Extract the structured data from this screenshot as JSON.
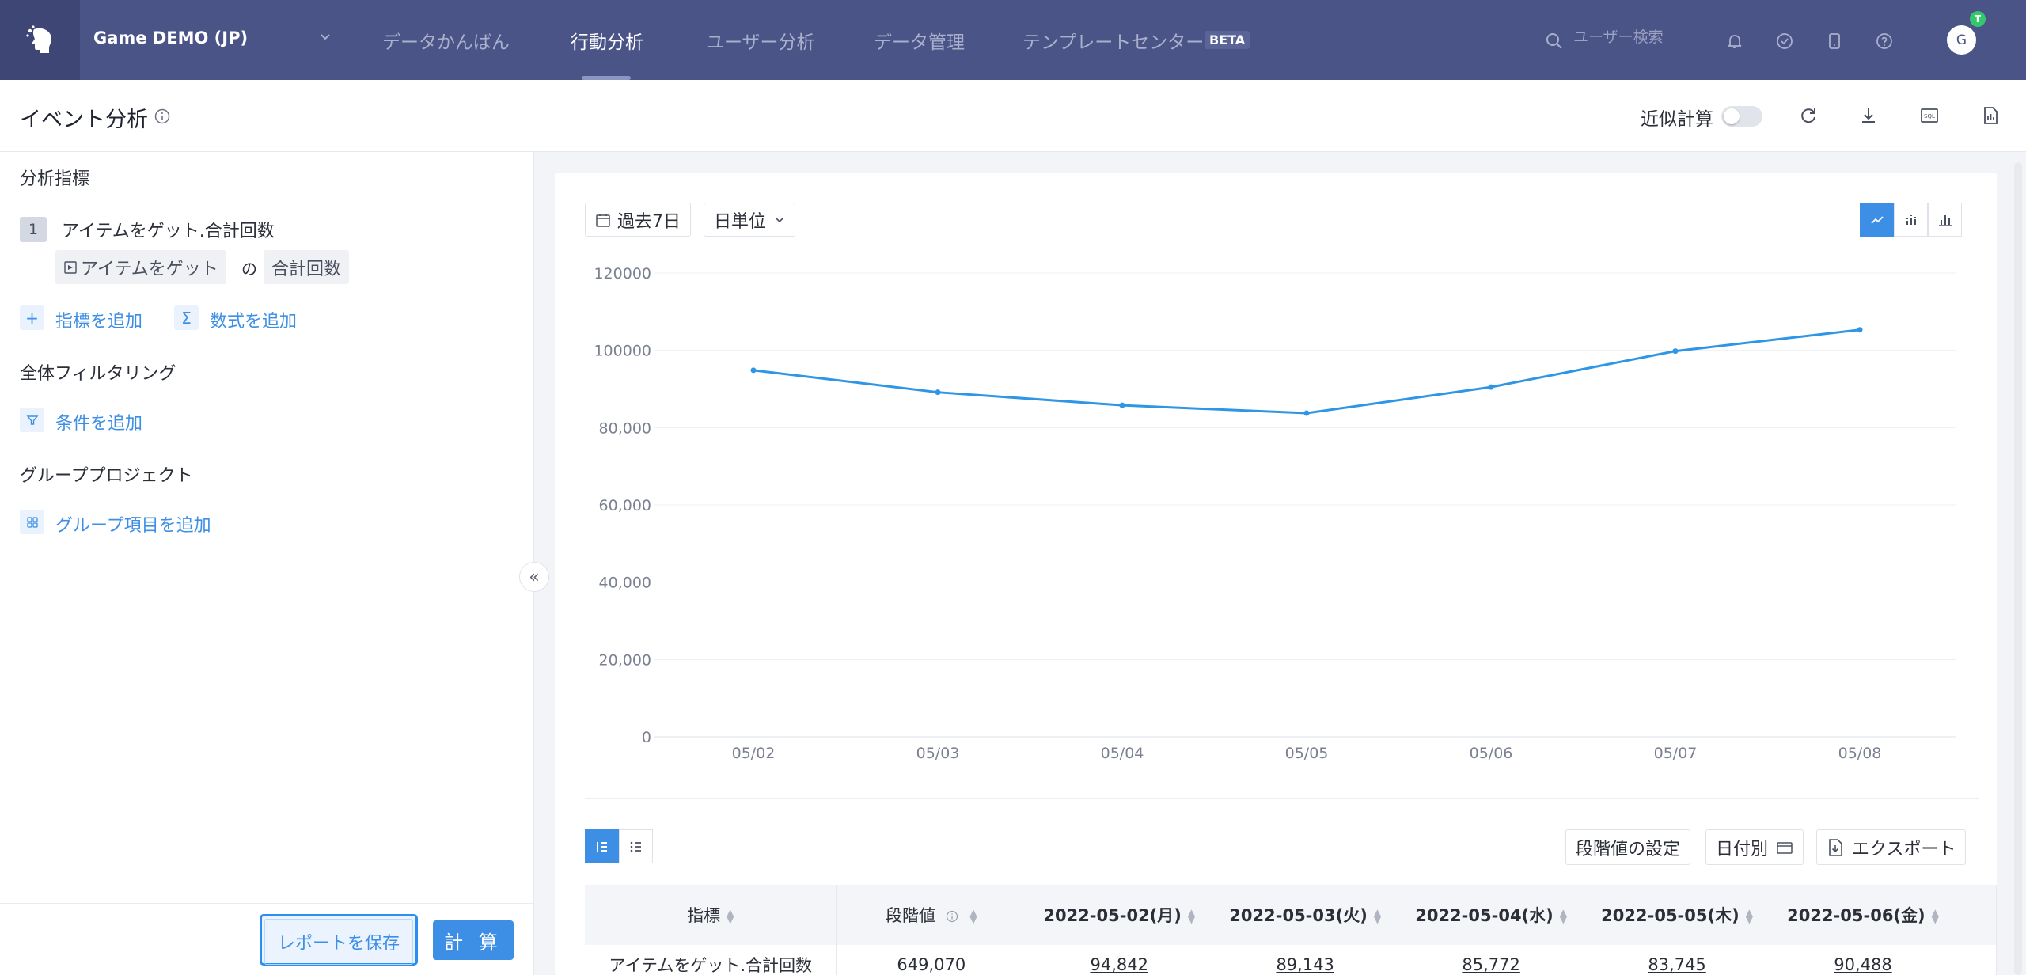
{
  "header": {
    "project_name": "Game DEMO (JP)",
    "nav": [
      {
        "label": "データかんばん",
        "active": false
      },
      {
        "label": "行動分析",
        "active": true
      },
      {
        "label": "ユーザー分析",
        "active": false
      },
      {
        "label": "データ管理",
        "active": false
      },
      {
        "label": "テンプレートセンター",
        "active": false
      }
    ],
    "beta_badge": "BETA",
    "search_placeholder": "ユーザー検索",
    "avatar_initial": "G",
    "avatar_badge": "T"
  },
  "subheader": {
    "title": "イベント分析",
    "approx_label": "近似計算",
    "approx_enabled": false
  },
  "left_panel": {
    "metrics_title": "分析指標",
    "metric": {
      "index": "1",
      "name": "アイテムをゲット.合計回数",
      "event_chip": "アイテムをゲット",
      "of_text": "の",
      "agg_chip": "合計回数"
    },
    "add_metric": "指標を追加",
    "add_formula": "数式を追加",
    "filter_title": "全体フィルタリング",
    "add_condition": "条件を追加",
    "group_title": "グループプロジェクト",
    "add_group": "グループ項目を追加",
    "save_report": "レポートを保存",
    "calculate": "計 算"
  },
  "toolbar": {
    "date_range": "過去7日",
    "granularity": "日単位"
  },
  "chart_data": {
    "type": "line",
    "categories": [
      "05/02",
      "05/03",
      "05/04",
      "05/05",
      "05/06",
      "05/07",
      "05/08"
    ],
    "series": [
      {
        "values": [
          94842,
          89143,
          85772,
          83745,
          90488,
          99800,
          105300
        ],
        "color": "#2f96e6"
      }
    ],
    "y_ticks": [
      "0",
      "20,000",
      "40,000",
      "60,000",
      "80,000",
      "100000",
      "120000"
    ],
    "ylim": [
      0,
      120000
    ],
    "grid": true,
    "title": "",
    "xlabel": "",
    "ylabel": ""
  },
  "table_toolbar": {
    "stage_setting": "段階値の設定",
    "by_date": "日付別",
    "export": "エクスポート"
  },
  "table": {
    "headers": [
      "指標",
      "段階値",
      "2022-05-02(月)",
      "2022-05-03(火)",
      "2022-05-04(水)",
      "2022-05-05(木)",
      "2022-05-06(金)"
    ],
    "rows": [
      [
        "アイテムをゲット.合計回数",
        "649,070",
        "94,842",
        "89,143",
        "85,772",
        "83,745",
        "90,488"
      ]
    ]
  }
}
